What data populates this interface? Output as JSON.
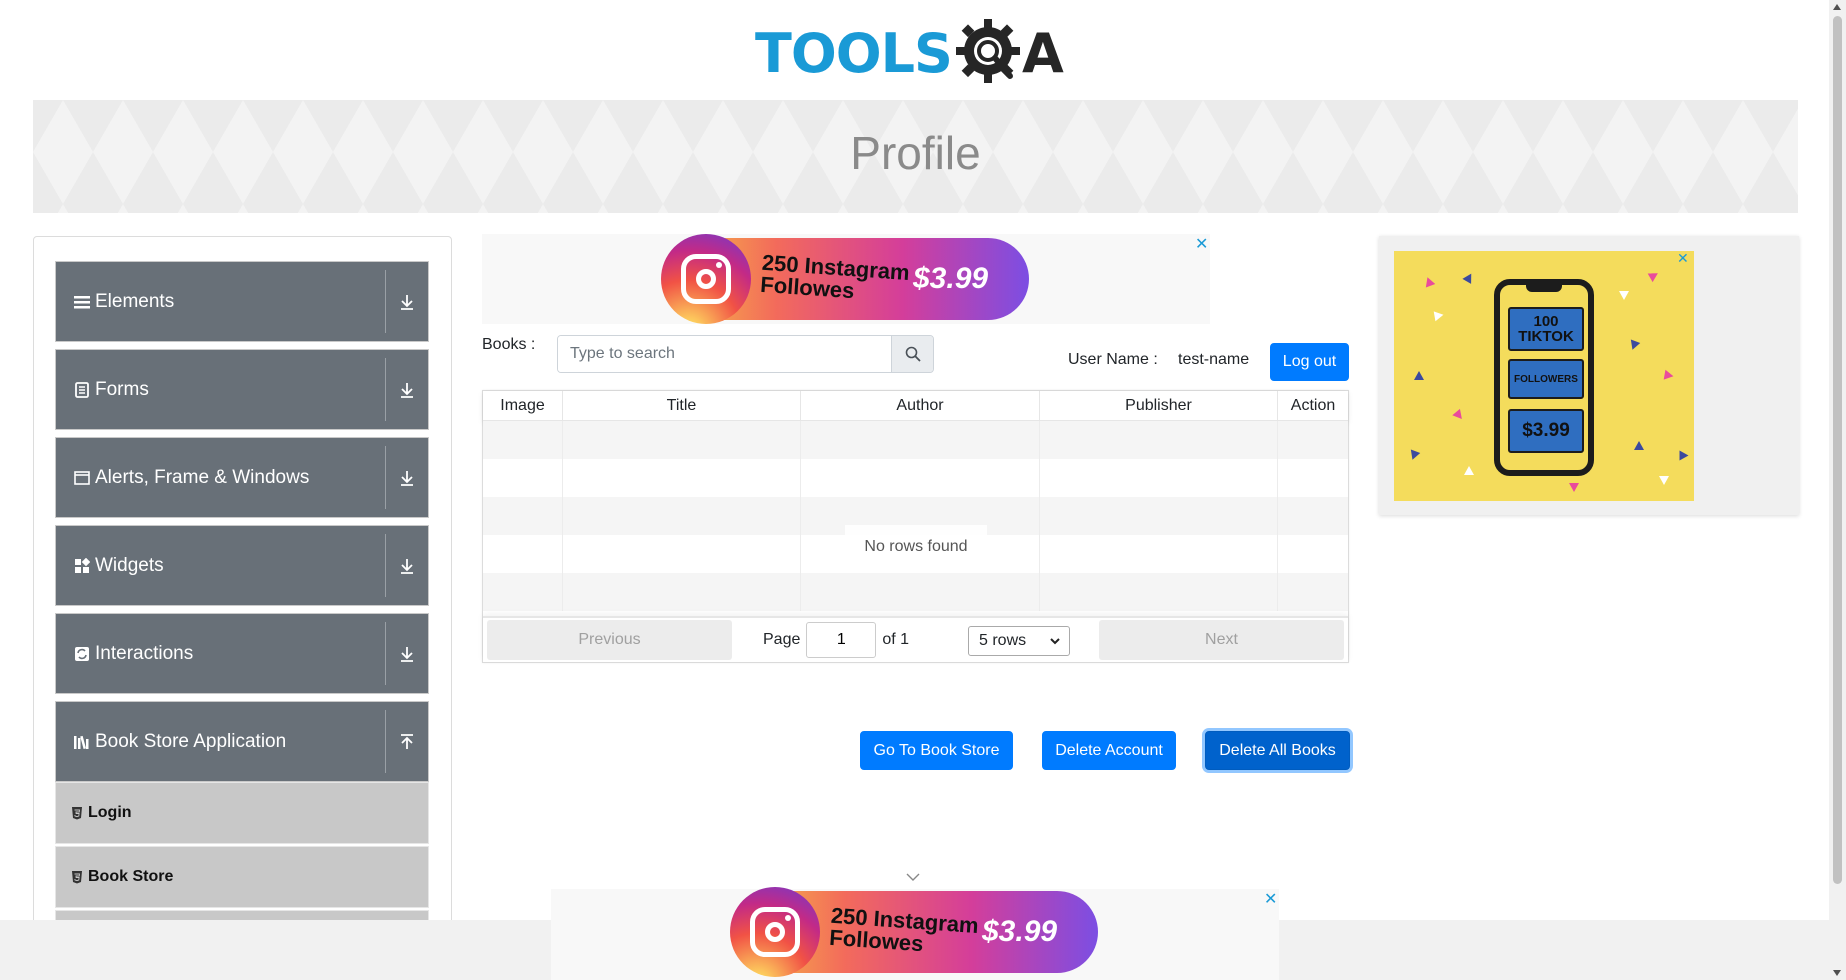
{
  "header": {
    "logo_text": "TOOLS",
    "logo_suffix": "A",
    "banner_title": "Profile"
  },
  "sidebar": {
    "groups": [
      {
        "label": "Elements",
        "icon": "menu-icon",
        "arrow": "download-arrow-icon"
      },
      {
        "label": "Forms",
        "icon": "document-icon",
        "arrow": "download-arrow-icon"
      },
      {
        "label": "Alerts, Frame & Windows",
        "icon": "window-icon",
        "arrow": "download-arrow-icon"
      },
      {
        "label": "Widgets",
        "icon": "widgets-icon",
        "arrow": "download-arrow-icon"
      },
      {
        "label": "Interactions",
        "icon": "interactions-icon",
        "arrow": "download-arrow-icon"
      },
      {
        "label": "Book Store Application",
        "icon": "library-icon",
        "arrow": "upload-arrow-icon"
      }
    ],
    "subitems": [
      {
        "label": "Login",
        "icon": "html5-icon"
      },
      {
        "label": "Book Store",
        "icon": "html5-icon"
      }
    ]
  },
  "ads": {
    "promo_text": "250 Instagram Followes",
    "promo_price": "$3.99",
    "close_glyph": "✕",
    "tiktok": {
      "line1": "100",
      "line2": "TIKTOK",
      "followers": "FOLLOWERS",
      "price": "$3.99"
    }
  },
  "books": {
    "label": "Books :",
    "search_placeholder": "Type to search",
    "search_value": "",
    "username_label": "User Name :",
    "username_value": "test-name",
    "logout_label": "Log out"
  },
  "table": {
    "columns": [
      "Image",
      "Title",
      "Author",
      "Publisher",
      "Action"
    ],
    "empty_text": "No rows found",
    "pagination": {
      "previous": "Previous",
      "next": "Next",
      "page_label": "Page",
      "page_value": "1",
      "of_label": "of 1",
      "rows_option": "5 rows"
    }
  },
  "actions": {
    "go_to_store": "Go To Book Store",
    "delete_account": "Delete Account",
    "delete_all_books": "Delete All Books"
  },
  "colors": {
    "primary": "#007bff",
    "sidebar_group": "#687078",
    "logo_blue": "#1a9ad6"
  }
}
